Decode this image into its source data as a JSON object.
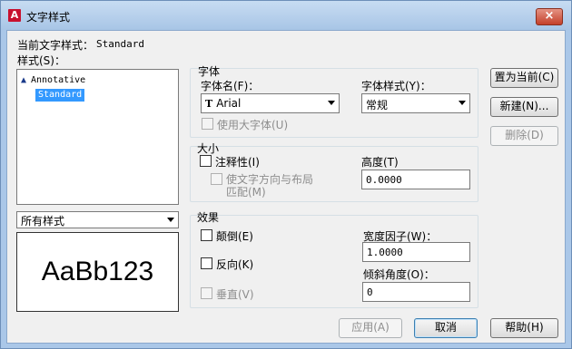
{
  "window": {
    "title": "文字样式",
    "app_icon": "autocad-a-icon",
    "close_label": "×"
  },
  "current_style": {
    "label": "当前文字样式：",
    "value": "Standard"
  },
  "styles": {
    "label": "样式(S)：",
    "items": [
      {
        "label": "Annotative",
        "icon": "annotative-icon",
        "selected": false
      },
      {
        "label": "Standard",
        "selected": true
      }
    ],
    "filter_value": "所有样式"
  },
  "preview": {
    "text": "AaBb123"
  },
  "font": {
    "group_label": "字体",
    "name_label": "字体名(F)：",
    "name_value": "Arial",
    "name_icon": "truetype-icon",
    "style_label": "字体样式(Y)：",
    "style_value": "常规",
    "big_font_label": "使用大字体(U)"
  },
  "size": {
    "group_label": "大小",
    "annotative_label": "注释性(I)",
    "match_orientation_line1": "使文字方向与布局",
    "match_orientation_line2": "匹配(M)",
    "height_label": "高度(T)",
    "height_value": "0.0000"
  },
  "effects": {
    "group_label": "效果",
    "upside_down_label": "颠倒(E)",
    "backwards_label": "反向(K)",
    "vertical_label": "垂直(V)",
    "width_factor_label": "宽度因子(W)：",
    "width_factor_value": "1.0000",
    "oblique_label": "倾斜角度(O)：",
    "oblique_value": "0"
  },
  "buttons": {
    "set_current": "置为当前(C)",
    "new": "新建(N)...",
    "delete": "删除(D)",
    "apply": "应用(A)",
    "cancel": "取消",
    "help": "帮助(H)"
  }
}
